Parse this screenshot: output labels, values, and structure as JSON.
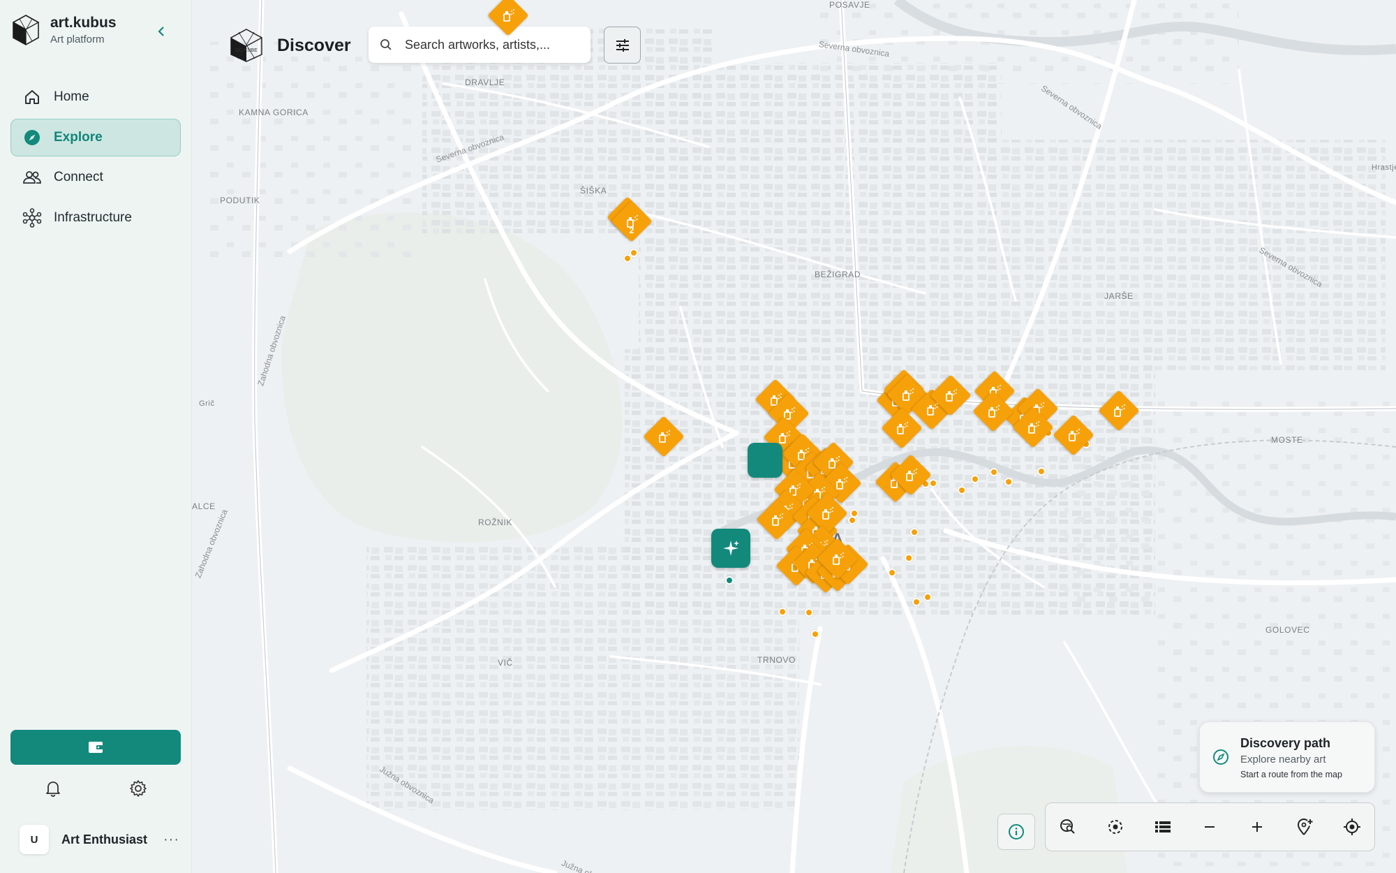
{
  "app": {
    "title": "art.kubus",
    "subtitle": "Art platform"
  },
  "sidebar": {
    "items": [
      {
        "label": "Home",
        "icon": "home-icon",
        "active": false
      },
      {
        "label": "Explore",
        "icon": "compass-icon",
        "active": true
      },
      {
        "label": "Connect",
        "icon": "people-icon",
        "active": false
      },
      {
        "label": "Infrastructure",
        "icon": "network-icon",
        "active": false
      }
    ],
    "wallet_icon": "wallet-icon"
  },
  "user": {
    "initial": "U",
    "name": "Art Enthusiast",
    "more": "···"
  },
  "header": {
    "logo_text": "DO KUBE",
    "title": "Discover"
  },
  "search": {
    "placeholder": "Search artworks, artists,..."
  },
  "map": {
    "places": [
      "POSAVJE",
      "DRAVLJE",
      "KAMNA GORICA",
      "ŠIŠKA",
      "PODUTIK",
      "BEŽIGRAD",
      "JARŠE",
      "Hrastje",
      "MOSTE",
      "Grič",
      "ALCE",
      "ROŽNIK",
      "VIČ",
      "TRNOVO",
      "GOLOVEC",
      "ANA"
    ],
    "roads": [
      "Severna obvoznica",
      "Zahodna obvoznica",
      "Južna obvoznica"
    ],
    "cluster_count": "2"
  },
  "discovery": {
    "title": "Discovery path",
    "subtitle": "Explore nearby art",
    "hint": "Start a route from the map"
  },
  "toolbar": {
    "buttons": [
      "search-area-icon",
      "recenter-icon",
      "list-icon",
      "zoom-out-icon",
      "zoom-in-icon",
      "add-marker-icon",
      "my-location-icon"
    ]
  },
  "colors": {
    "accent": "#13897c",
    "marker": "#f7a10a",
    "sidebar_bg": "#eef4f2"
  }
}
